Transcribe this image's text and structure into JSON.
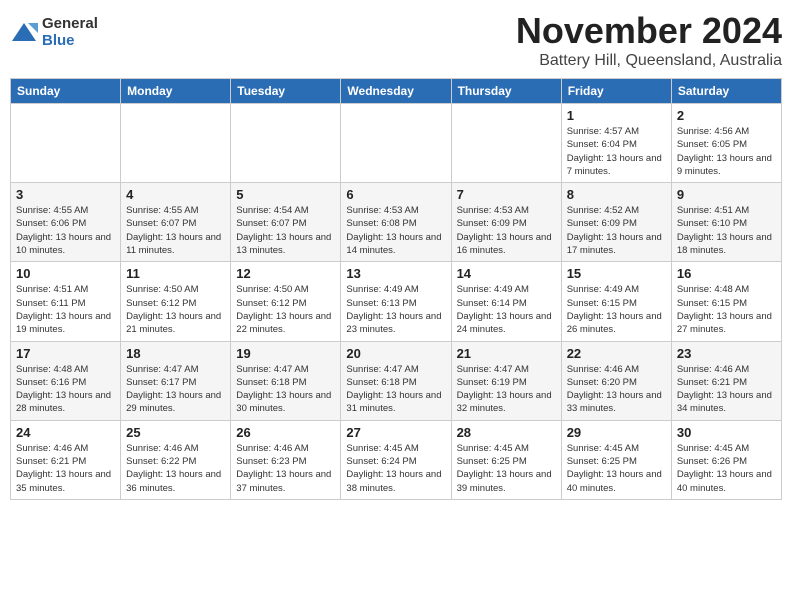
{
  "logo": {
    "general": "General",
    "blue": "Blue"
  },
  "title": "November 2024",
  "location": "Battery Hill, Queensland, Australia",
  "days_of_week": [
    "Sunday",
    "Monday",
    "Tuesday",
    "Wednesday",
    "Thursday",
    "Friday",
    "Saturday"
  ],
  "weeks": [
    [
      {
        "day": "",
        "info": ""
      },
      {
        "day": "",
        "info": ""
      },
      {
        "day": "",
        "info": ""
      },
      {
        "day": "",
        "info": ""
      },
      {
        "day": "",
        "info": ""
      },
      {
        "day": "1",
        "info": "Sunrise: 4:57 AM\nSunset: 6:04 PM\nDaylight: 13 hours and 7 minutes."
      },
      {
        "day": "2",
        "info": "Sunrise: 4:56 AM\nSunset: 6:05 PM\nDaylight: 13 hours and 9 minutes."
      }
    ],
    [
      {
        "day": "3",
        "info": "Sunrise: 4:55 AM\nSunset: 6:06 PM\nDaylight: 13 hours and 10 minutes."
      },
      {
        "day": "4",
        "info": "Sunrise: 4:55 AM\nSunset: 6:07 PM\nDaylight: 13 hours and 11 minutes."
      },
      {
        "day": "5",
        "info": "Sunrise: 4:54 AM\nSunset: 6:07 PM\nDaylight: 13 hours and 13 minutes."
      },
      {
        "day": "6",
        "info": "Sunrise: 4:53 AM\nSunset: 6:08 PM\nDaylight: 13 hours and 14 minutes."
      },
      {
        "day": "7",
        "info": "Sunrise: 4:53 AM\nSunset: 6:09 PM\nDaylight: 13 hours and 16 minutes."
      },
      {
        "day": "8",
        "info": "Sunrise: 4:52 AM\nSunset: 6:09 PM\nDaylight: 13 hours and 17 minutes."
      },
      {
        "day": "9",
        "info": "Sunrise: 4:51 AM\nSunset: 6:10 PM\nDaylight: 13 hours and 18 minutes."
      }
    ],
    [
      {
        "day": "10",
        "info": "Sunrise: 4:51 AM\nSunset: 6:11 PM\nDaylight: 13 hours and 19 minutes."
      },
      {
        "day": "11",
        "info": "Sunrise: 4:50 AM\nSunset: 6:12 PM\nDaylight: 13 hours and 21 minutes."
      },
      {
        "day": "12",
        "info": "Sunrise: 4:50 AM\nSunset: 6:12 PM\nDaylight: 13 hours and 22 minutes."
      },
      {
        "day": "13",
        "info": "Sunrise: 4:49 AM\nSunset: 6:13 PM\nDaylight: 13 hours and 23 minutes."
      },
      {
        "day": "14",
        "info": "Sunrise: 4:49 AM\nSunset: 6:14 PM\nDaylight: 13 hours and 24 minutes."
      },
      {
        "day": "15",
        "info": "Sunrise: 4:49 AM\nSunset: 6:15 PM\nDaylight: 13 hours and 26 minutes."
      },
      {
        "day": "16",
        "info": "Sunrise: 4:48 AM\nSunset: 6:15 PM\nDaylight: 13 hours and 27 minutes."
      }
    ],
    [
      {
        "day": "17",
        "info": "Sunrise: 4:48 AM\nSunset: 6:16 PM\nDaylight: 13 hours and 28 minutes."
      },
      {
        "day": "18",
        "info": "Sunrise: 4:47 AM\nSunset: 6:17 PM\nDaylight: 13 hours and 29 minutes."
      },
      {
        "day": "19",
        "info": "Sunrise: 4:47 AM\nSunset: 6:18 PM\nDaylight: 13 hours and 30 minutes."
      },
      {
        "day": "20",
        "info": "Sunrise: 4:47 AM\nSunset: 6:18 PM\nDaylight: 13 hours and 31 minutes."
      },
      {
        "day": "21",
        "info": "Sunrise: 4:47 AM\nSunset: 6:19 PM\nDaylight: 13 hours and 32 minutes."
      },
      {
        "day": "22",
        "info": "Sunrise: 4:46 AM\nSunset: 6:20 PM\nDaylight: 13 hours and 33 minutes."
      },
      {
        "day": "23",
        "info": "Sunrise: 4:46 AM\nSunset: 6:21 PM\nDaylight: 13 hours and 34 minutes."
      }
    ],
    [
      {
        "day": "24",
        "info": "Sunrise: 4:46 AM\nSunset: 6:21 PM\nDaylight: 13 hours and 35 minutes."
      },
      {
        "day": "25",
        "info": "Sunrise: 4:46 AM\nSunset: 6:22 PM\nDaylight: 13 hours and 36 minutes."
      },
      {
        "day": "26",
        "info": "Sunrise: 4:46 AM\nSunset: 6:23 PM\nDaylight: 13 hours and 37 minutes."
      },
      {
        "day": "27",
        "info": "Sunrise: 4:45 AM\nSunset: 6:24 PM\nDaylight: 13 hours and 38 minutes."
      },
      {
        "day": "28",
        "info": "Sunrise: 4:45 AM\nSunset: 6:25 PM\nDaylight: 13 hours and 39 minutes."
      },
      {
        "day": "29",
        "info": "Sunrise: 4:45 AM\nSunset: 6:25 PM\nDaylight: 13 hours and 40 minutes."
      },
      {
        "day": "30",
        "info": "Sunrise: 4:45 AM\nSunset: 6:26 PM\nDaylight: 13 hours and 40 minutes."
      }
    ]
  ]
}
